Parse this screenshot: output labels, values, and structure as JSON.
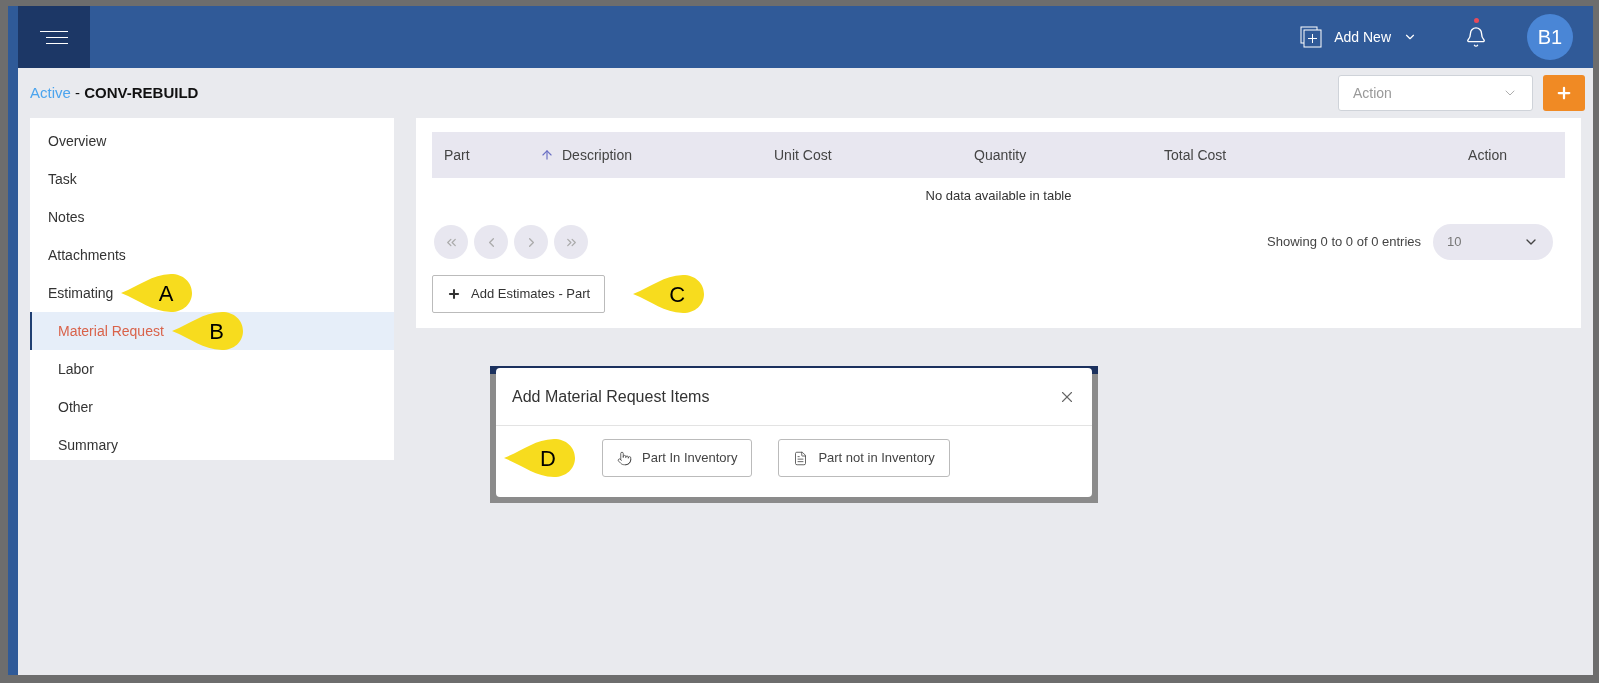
{
  "header": {
    "add_new": "Add New",
    "avatar": "B1",
    "notification_dot": true
  },
  "breadcrumb": {
    "status": "Active",
    "separator": " - ",
    "name": "CONV-REBUILD"
  },
  "action_select": {
    "placeholder": "Action"
  },
  "sidebar": {
    "items": [
      {
        "label": "Overview",
        "selected": false
      },
      {
        "label": "Task",
        "selected": false
      },
      {
        "label": "Notes",
        "selected": false
      },
      {
        "label": "Attachments",
        "selected": false
      },
      {
        "label": "Estimating",
        "selected": false,
        "callout": "A",
        "children": [
          {
            "label": "Material Request",
            "selected": true,
            "callout": "B"
          },
          {
            "label": "Labor",
            "selected": false
          },
          {
            "label": "Other",
            "selected": false
          },
          {
            "label": "Summary",
            "selected": false
          }
        ]
      }
    ]
  },
  "table": {
    "columns": [
      {
        "label": "Part",
        "sorted": false
      },
      {
        "label": "Description",
        "sorted": true
      },
      {
        "label": "Unit Cost",
        "sorted": false
      },
      {
        "label": "Quantity",
        "sorted": false
      },
      {
        "label": "Total Cost",
        "sorted": false
      },
      {
        "label": "Action",
        "sorted": false
      }
    ],
    "empty_message": "No data available in table",
    "info": "Showing 0 to 0 of 0 entries",
    "page_size": "10"
  },
  "add_button": {
    "label": "Add Estimates - Part",
    "callout": "C"
  },
  "dialog": {
    "title": "Add Material Request Items",
    "callout": "D",
    "buttons": [
      {
        "label": "Part In Inventory",
        "kind": "hand"
      },
      {
        "label": "Part not in Inventory",
        "kind": "document"
      }
    ]
  }
}
